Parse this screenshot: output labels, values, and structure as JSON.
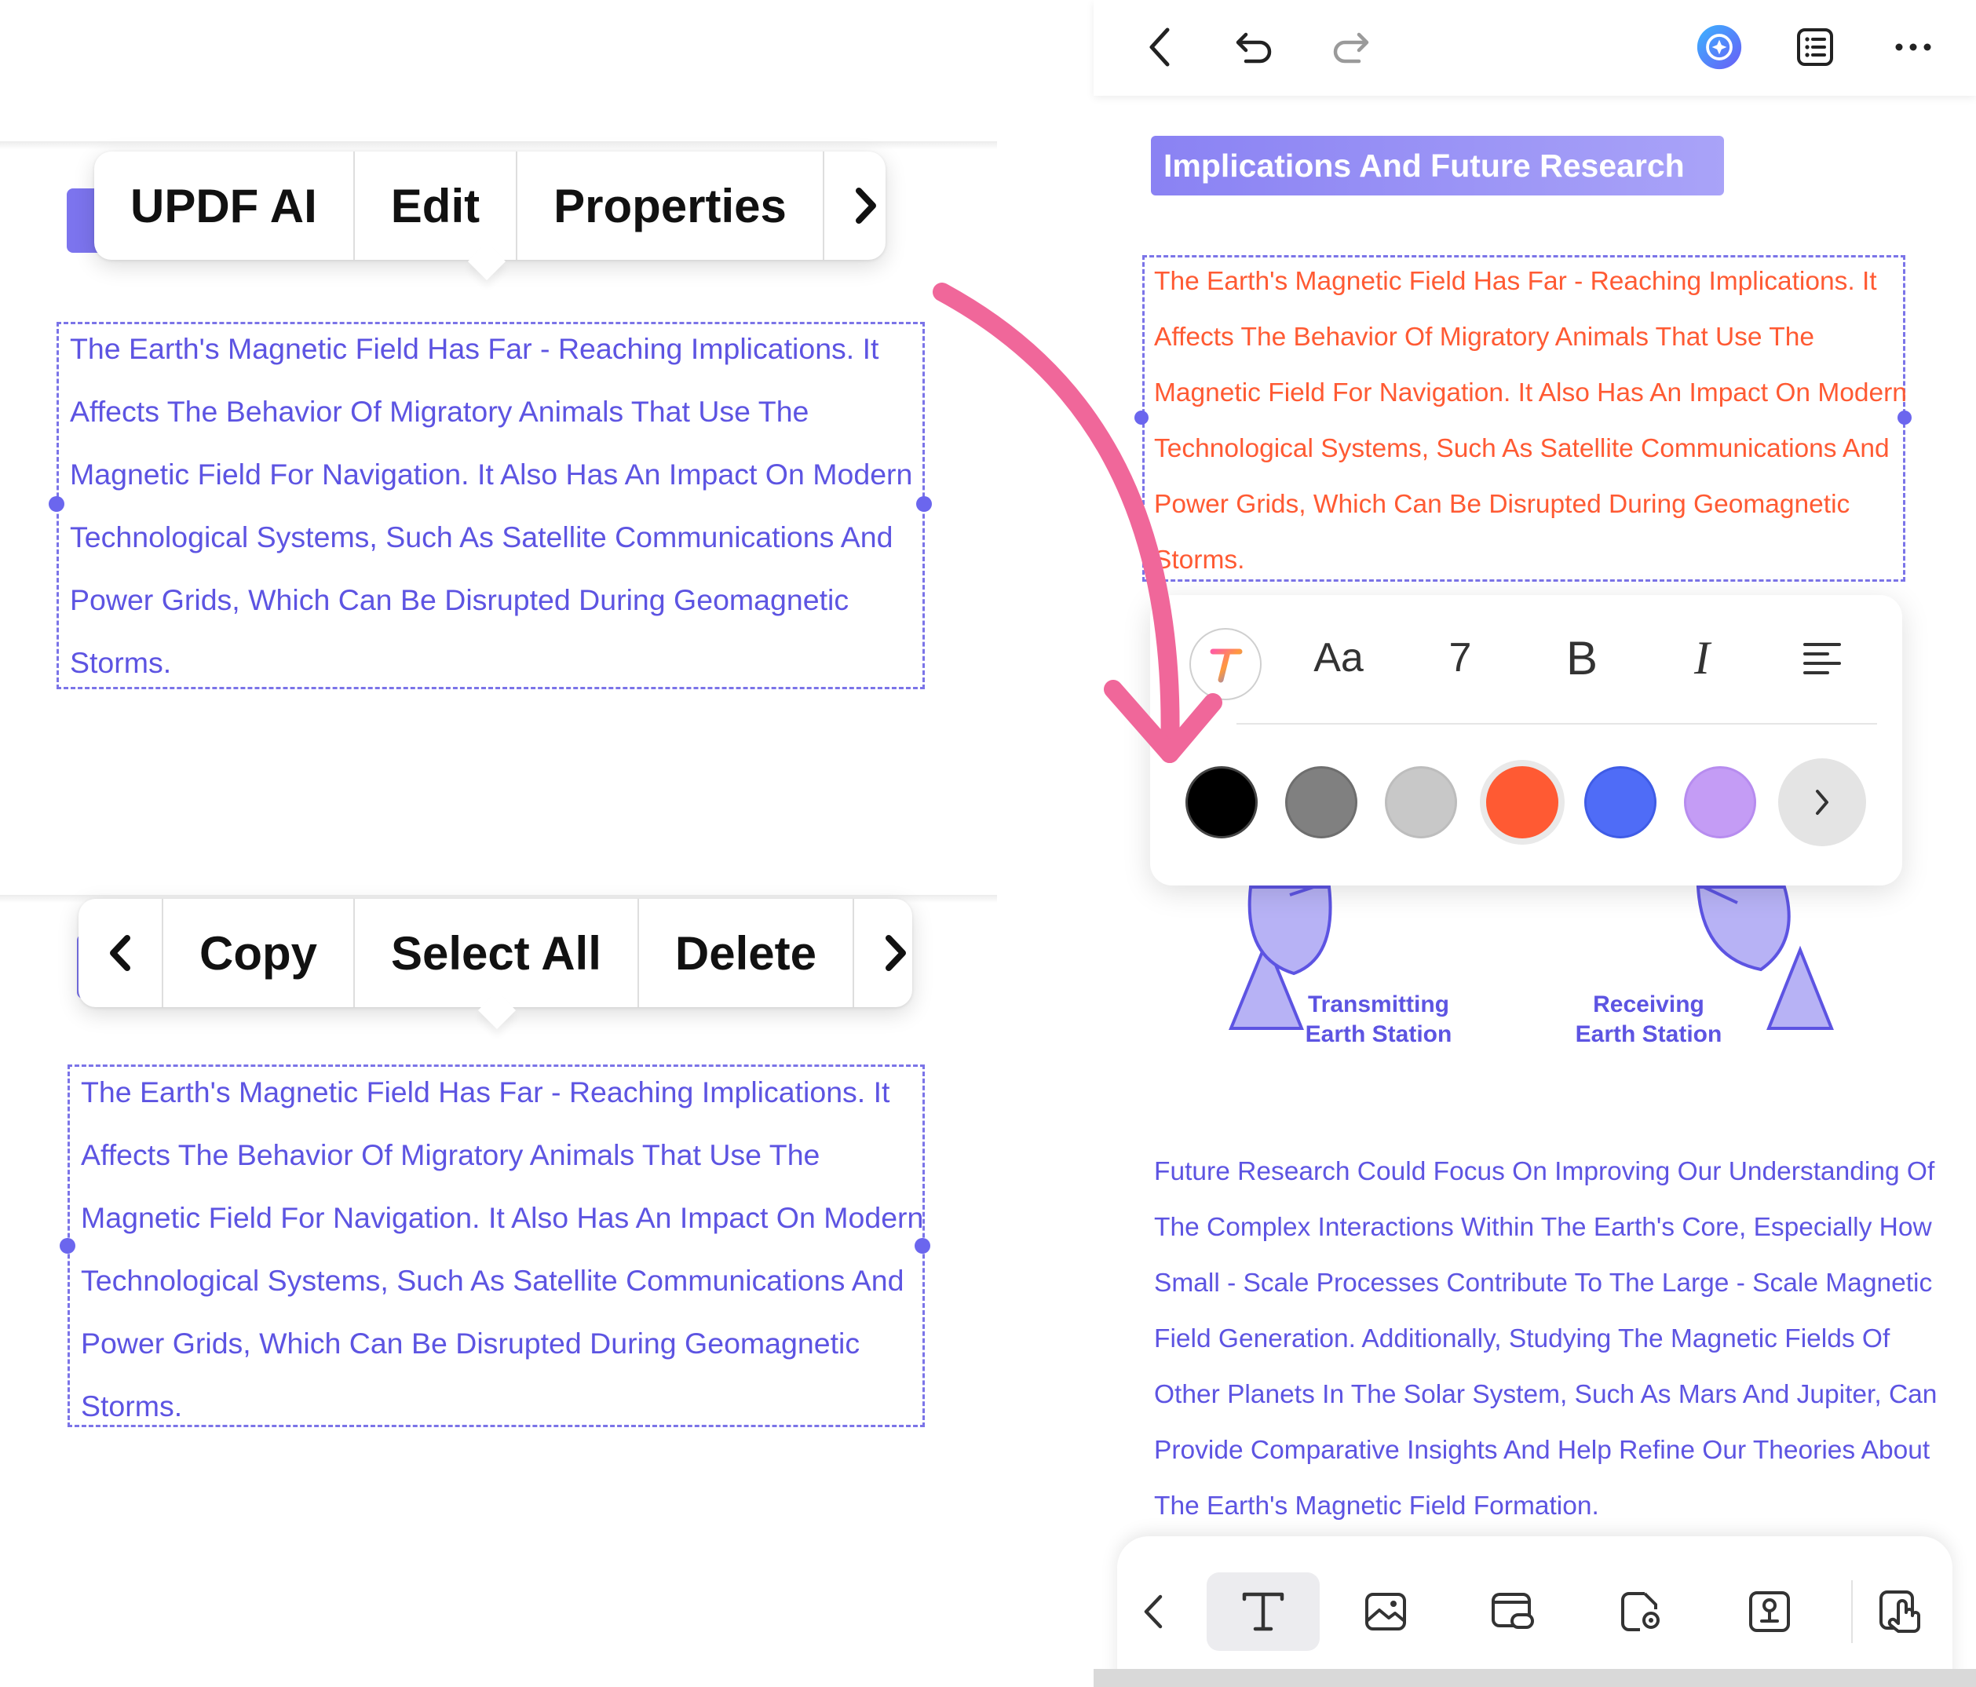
{
  "left_top_menu": {
    "items": [
      "UPDF AI",
      "Edit",
      "Properties"
    ],
    "more_icon": "chevron-right-icon"
  },
  "left_bottom_menu": {
    "back_icon": "chevron-left-icon",
    "items": [
      "Copy",
      "Select All",
      "Delete"
    ],
    "more_icon": "chevron-right-icon"
  },
  "left_text_block": {
    "lines": [
      "The Earth's Magnetic Field Has Far - Reaching Implications. It",
      "Affects The Behavior Of Migratory Animals That Use The",
      "Magnetic Field For Navigation. It Also Has An Impact On Modern",
      "Technological Systems, Such As Satellite Communications And",
      "Power Grids, Which Can Be Disrupted During Geomagnetic",
      "Storms."
    ]
  },
  "right_panel": {
    "toolbar_icons": [
      "back-icon",
      "undo-icon",
      "redo-icon",
      "ai-assistant-icon",
      "outline-icon",
      "more-icon"
    ],
    "heading": "Implications And Future Research",
    "text_block": {
      "lines": [
        "The Earth's Magnetic Field Has Far - Reaching Implications. It",
        "Affects The Behavior Of Migratory Animals That Use The",
        "Magnetic Field For Navigation. It Also Has An Impact On Modern",
        "Technological Systems, Such As Satellite Communications And",
        "Power Grids, Which Can Be Disrupted During Geomagnetic",
        "Storms."
      ],
      "color": "#ff5a33"
    },
    "format_toolbar": {
      "font_label": "Aa",
      "size_value": "7",
      "bold_label": "B",
      "italic_label": "I",
      "colors": [
        "#000000",
        "#808080",
        "#c8c8c8",
        "#ff5a33",
        "#4f6cf7",
        "#c49cf5"
      ],
      "selected_color": "#ff5a33"
    },
    "illustration": {
      "left_label": [
        "Transmitting",
        "Earth Station"
      ],
      "right_label": [
        "Receiving",
        "Earth Station"
      ]
    },
    "paragraph": [
      "Future Research Could Focus On Improving Our Understanding Of",
      "The Complex Interactions Within The Earth's Core, Especially How",
      "Small - Scale Processes Contribute To The Large - Scale Magnetic",
      "Field Generation. Additionally, Studying The Magnetic Fields Of",
      "Other Planets In The Solar System, Such As Mars And Jupiter, Can",
      "Provide Comparative Insights And Help Refine Our Theories About",
      "The Earth's Magnetic Field Formation."
    ],
    "bottom_toolbar_icons": [
      "back-icon",
      "text-tool-icon",
      "image-tool-icon",
      "link-tool-icon",
      "stamp-tool-icon",
      "signature-tool-icon",
      "gesture-tool-icon"
    ],
    "active_tool": "text-tool-icon"
  },
  "colors": {
    "accent": "#6b66ee",
    "text_blue": "#5d54e2",
    "annotation_arrow": "#f0679a"
  }
}
